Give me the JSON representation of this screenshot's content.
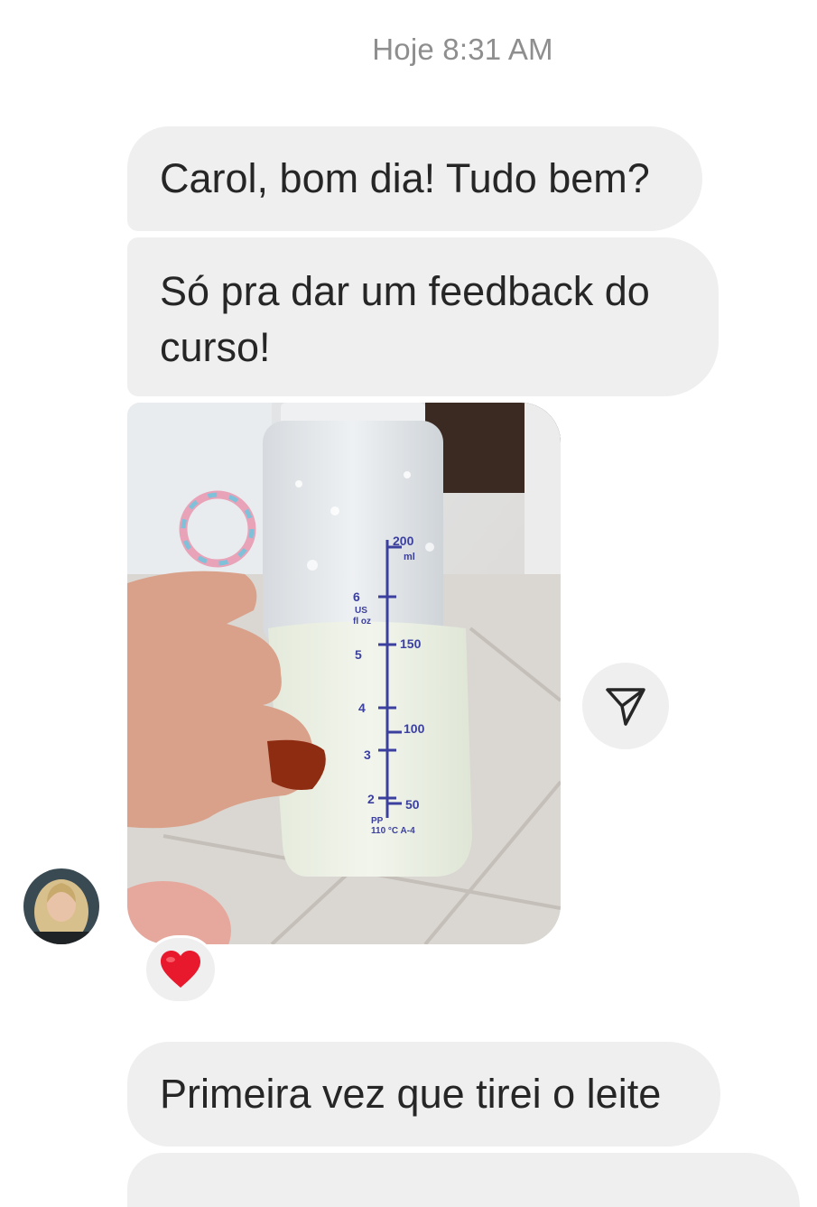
{
  "conversation": {
    "timestamp": "Hoje 8:31 AM",
    "messages": [
      {
        "type": "text",
        "text": "Carol, bom dia! Tudo bem?"
      },
      {
        "type": "text",
        "text": "Só pra dar um feedback do curso!"
      },
      {
        "type": "image",
        "icon": "baby-bottle-photo"
      },
      {
        "type": "text",
        "text": "Primeira vez que tirei o leite"
      },
      {
        "type": "text",
        "text": ""
      }
    ],
    "reaction": {
      "icon": "heart-icon",
      "color": "#e8192c"
    }
  },
  "bottle_scale": {
    "ml_labels": [
      "200",
      "ml",
      "150",
      "100",
      "50"
    ],
    "oz_labels": [
      "6",
      "5",
      "4",
      "3",
      "2"
    ],
    "oz_unit": "US",
    "oz_unit2": "fl oz",
    "material": "PP",
    "temp": "110 °C A-4"
  },
  "share_button": {
    "icon": "send-icon"
  },
  "sender": {
    "avatar": "avatar-photo"
  },
  "colors": {
    "bubble": "#efefef",
    "text": "#262626",
    "timestamp": "#8e8e8e",
    "scale": "#3b3f9e"
  }
}
